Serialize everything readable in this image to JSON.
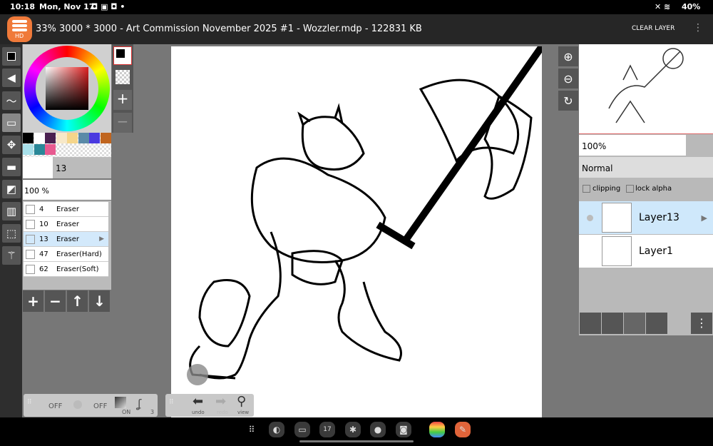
{
  "status": {
    "time": "10:18",
    "date": "Mon, Nov 17",
    "battery": "40%"
  },
  "appbar": {
    "logo_badge": "HD",
    "title": "33% 3000 * 3000 - Art Commission November 2025 #1 - Wozzler.mdp - 122831 KB",
    "clear_layer": "CLEAR LAYER"
  },
  "palette": [
    "#000000",
    "#ffffff",
    "#4a2050",
    "#f7e8c8",
    "#f5d58a",
    "#5a8aa8",
    "#4a3ae0",
    "#c0651e",
    "#a8e0ea",
    "#2a8898",
    "#e85a90"
  ],
  "brush": {
    "size": "13",
    "opacity": "100 %",
    "items": [
      {
        "size": "4",
        "name": "Eraser"
      },
      {
        "size": "10",
        "name": "Eraser"
      },
      {
        "size": "13",
        "name": "Eraser",
        "selected": true
      },
      {
        "size": "47",
        "name": "Eraser(Hard)"
      },
      {
        "size": "62",
        "name": "Eraser(Soft)"
      }
    ]
  },
  "bottombar": {
    "off1": "OFF",
    "off2": "OFF",
    "on": "ON",
    "stab": "3",
    "undo": "undo",
    "redo": "redo",
    "view": "view"
  },
  "layers": {
    "opacity": "100%",
    "blend": "Normal",
    "clipping": "clipping",
    "lock_alpha": "lock alpha",
    "items": [
      {
        "name": "Layer13",
        "selected": true
      },
      {
        "name": "Layer1"
      }
    ]
  },
  "nav": {
    "calendar_day": "17"
  }
}
